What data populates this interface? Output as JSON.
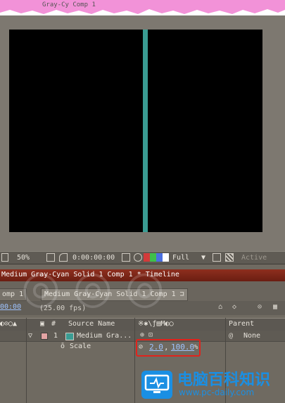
{
  "window": {
    "title_fragment": "Gray-Cy Comp 1"
  },
  "viewer": {
    "zoom": "50%",
    "timecode": "0:00:00:00",
    "resolution": "Full",
    "view": "Active",
    "channel_colors": [
      "#d23a3a",
      "#3fbf4a",
      "#4a6fe0",
      "#ffffff"
    ]
  },
  "timeline": {
    "title": "Medium Gray-Cyan Solid 1 Comp 1 * Timeline",
    "left_tab": "omp 1",
    "active_tab": "Medium Gray-Cyan Solid 1 Comp 1",
    "current_time": "00:00",
    "fps": "(25.00 fps)",
    "columns": {
      "number": "#",
      "source_name": "Source Name",
      "parent": "Parent"
    },
    "layer": {
      "number": "1",
      "name": "Medium Gra...",
      "parent": "None",
      "swatch_color": "#3a9c93",
      "label_color": "#e2a3a3"
    },
    "property": {
      "name": "Scale",
      "x": "2.0",
      "separator": ",",
      "y": "100.0",
      "unit": "%"
    }
  },
  "watermarks": {
    "brand_text": "电脑百科知识",
    "brand_url": "www.pc-daily.com"
  },
  "icons": [
    "grid-icon",
    "mask-icon",
    "camera-icon",
    "color-channels-icon",
    "transparency-grid-icon",
    "chain-link-icon",
    "stopwatch-icon",
    "parent-pickwhip-icon",
    "twirl-down-icon"
  ]
}
